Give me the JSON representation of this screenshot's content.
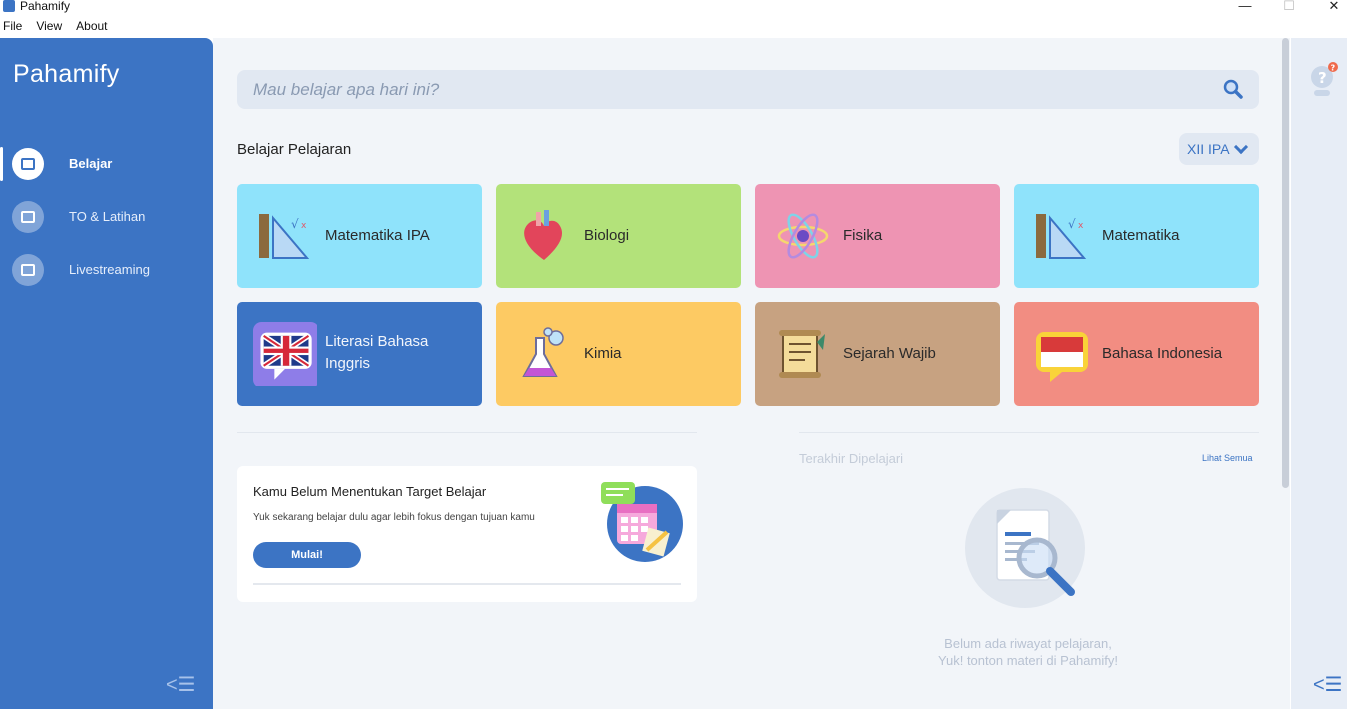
{
  "window": {
    "title": "Pahamify",
    "minimize": "—",
    "maximize": "☐",
    "close": "✕"
  },
  "menu": [
    "File",
    "View",
    "About"
  ],
  "brand": {
    "name": "Pahamify",
    "accent": "#3c74c4"
  },
  "sidebar": {
    "items": [
      {
        "label": "Belajar",
        "icon": "book-icon",
        "active": true
      },
      {
        "label": "TO & Latihan",
        "icon": "edit-icon",
        "active": false
      },
      {
        "label": "Livestreaming",
        "icon": "video-icon",
        "active": false
      }
    ],
    "collapse_icon": "collapse-left-icon"
  },
  "search": {
    "placeholder": "Mau belajar apa hari ini?"
  },
  "subjects": {
    "title": "Belajar Pelajaran",
    "grade": "XII IPA",
    "cards": [
      {
        "label": "Matematika IPA",
        "color": "#8fe3fb",
        "icon": "ruler-icon"
      },
      {
        "label": "Biologi",
        "color": "#b3e27a",
        "icon": "heart-icon"
      },
      {
        "label": "Fisika",
        "color": "#ee94b3",
        "icon": "atom-icon"
      },
      {
        "label": "Matematika",
        "color": "#8fe3fb",
        "icon": "ruler-icon"
      },
      {
        "label": "Literasi Bahasa Inggris",
        "color": "#3c74c4",
        "icon": "uk-flag-icon"
      },
      {
        "label": "Kimia",
        "color": "#fdca63",
        "icon": "flask-icon"
      },
      {
        "label": "Sejarah Wajib",
        "color": "#c7a281",
        "icon": "scroll-icon"
      },
      {
        "label": "Bahasa Indonesia",
        "color": "#f28d82",
        "icon": "id-flag-icon"
      }
    ]
  },
  "target": {
    "title": "Kamu Belum Menentukan Target Belajar",
    "subtitle": "Yuk sekarang belajar dulu agar lebih fokus dengan tujuan kamu",
    "button": "Mulai!"
  },
  "recent": {
    "title": "Terakhir Dipelajari",
    "link": "Lihat Semua",
    "empty_line1": "Belum ada riwayat pelajaran,",
    "empty_line2": "Yuk! tonton materi di Pahamify!"
  },
  "right_panel": {
    "help_icon": "help-icon",
    "badge": "?",
    "collapse_icon": "collapse-right-icon"
  }
}
